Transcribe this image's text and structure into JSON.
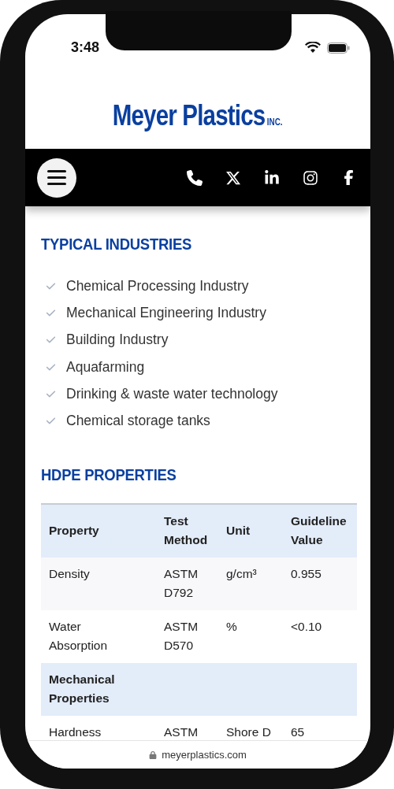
{
  "status_bar": {
    "time": "3:48"
  },
  "logo": {
    "name": "Meyer Plastics",
    "suffix": "INC."
  },
  "sections": [
    {
      "kind": "list",
      "title": "TYPICAL INDUSTRIES",
      "items": [
        "Chemical Processing Industry",
        "Mechanical Engineering Industry",
        "Building Industry",
        "Aquafarming",
        "Drinking & waste water technology",
        "Chemical storage tanks"
      ]
    },
    {
      "kind": "table",
      "title": "HDPE PROPERTIES",
      "columns": [
        "Property",
        "Test Method",
        "Unit",
        "Guideline Value"
      ],
      "rows": [
        {
          "kind": "data",
          "cells": [
            "Density",
            "ASTM D792",
            "g/cm³",
            "0.955"
          ]
        },
        {
          "kind": "data",
          "cells": [
            "Water Absorption",
            "ASTM D570",
            "%",
            "<0.10"
          ]
        },
        {
          "kind": "section",
          "cells": [
            "Mechanical Properties"
          ]
        },
        {
          "kind": "data",
          "cells": [
            "Hardness",
            "ASTM",
            "Shore D",
            "65"
          ]
        }
      ]
    }
  ],
  "address_bar": {
    "url": "meyerplastics.com"
  }
}
